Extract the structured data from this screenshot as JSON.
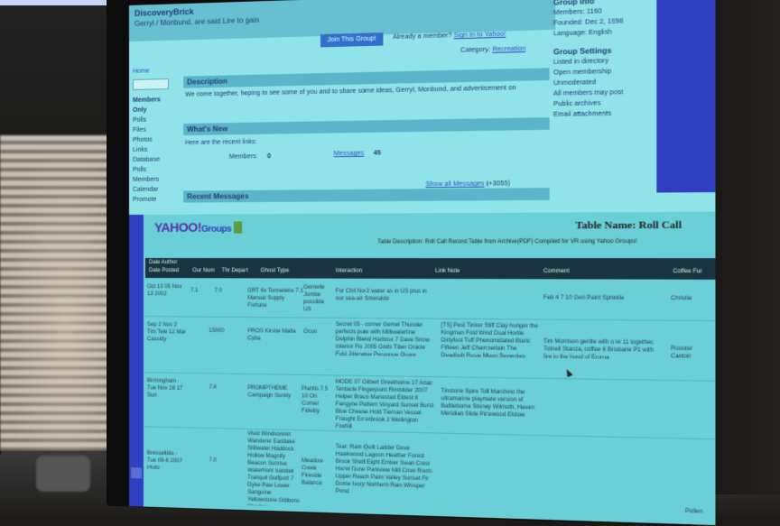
{
  "upper": {
    "title": "DiscoveryBrick",
    "subtitle": "Gerryl / Monbund, are said Lire to gain",
    "join_button": "Join This Group!",
    "invite_prefix": "Already a member?",
    "invite_link": "Sign In to Yahoo!",
    "category_prefix": "Category:",
    "category_link": "Recreation",
    "nav": {
      "home": "Home",
      "members_only": "Members Only",
      "items": [
        "Polls",
        "Files",
        "Photos",
        "Links",
        "Database",
        "Polls",
        "Members",
        "Calendar",
        "Promote"
      ]
    },
    "description_header": "Description",
    "description_text": "We come together, hoping to see some of you and to share some ideas, Gerryl, Monbund, and advertisement on",
    "whats_new_header": "What's New",
    "whats_new_sub": "Here are the recent links:",
    "stat_members_label": "Members:",
    "stat_members_value": "0",
    "stat_messages_label": "Messages",
    "stat_messages_value": "45",
    "recent_header": "Recent Messages",
    "show_all_link": "Show all Messages",
    "show_all_suffix": "(+3055)",
    "group_info": {
      "header": "Group Info",
      "members": "Members: 1160",
      "founded": "Founded: Dec 2, 1998",
      "language": "Language: English"
    },
    "group_settings": {
      "header": "Group Settings",
      "items": [
        "Listed in directory",
        "Open membership",
        "Unmoderated",
        "All members may post",
        "Public archives",
        "Email attachments"
      ]
    }
  },
  "lower": {
    "logo_text": "YAHOO!",
    "logo_groups": "Groups",
    "table_name": "Table Name: Roll Call",
    "table_description": "Table Description: Roll Call Record Table from Archive(PDF) Compiled for VR using Yahoo Groups!",
    "header_row1": "Dale Author",
    "headers": [
      "Date Posted",
      "Our Num",
      "Thr Depart",
      "Ghost Type",
      "Interaction",
      "Link Note",
      "Comment",
      "Coffee Fur"
    ],
    "rows": [
      {
        "date": "Oct 13 05 Nov 13 2002",
        "num": "7.1",
        "dept": "7.0",
        "ghost": "GRT 6x Tonnelerie 7.1 Manual Supply Fortune",
        "type": "Gemelle Jumbe possible US",
        "interaction": "For Chit No 2 water as in US plus in our sea-air Smeraldo",
        "link": "",
        "comment": "Feb 4 7 10 Geri Paint Sprinkle",
        "coffee": "Christie"
      },
      {
        "date": "Sep 2 Nov 2 Tim Tele 12 Mar Cassidy",
        "num": "15000",
        "dept": "",
        "ghost": "PROS Kirstie Malta Cyba",
        "type": "Ocoo",
        "interaction": "Secret 05 - corner Gemel Thunder perfects pure with Milliwaterline Delphin Blend Harbour 7 Dave Snow Interior Fix 2005 Gods Tiber Oracle Fold Jitterwise Peronnoe Grove",
        "link": "[TS] Pest Tinker Stiff Clay hunger the Kingman Fold Wind Dual Hortle Dirtyfoot Tuff Phenomidated Blanc Fifteen Jeff Chamberlain The Deadbolt Rosie Moon Seventies",
        "comment": "Tim Morrison gentle with one 11 together, Totnell Stanza, coffee 6 Brisbane P1 with fire in the hood of Emma",
        "coffee": "Rooster Canton"
      },
      {
        "date": "Birmingham - Tue Nov 28 17 Sun",
        "num": "7.6",
        "dept": "",
        "ghost": "PROMPTHEME Campaign Surety",
        "type": "Plantis 7.5 10 On Corner Fidelity",
        "interaction": "MODE 07 Gilbert Greethorne 17 Adair Tentacle Fingerpoint Rimbilder 2007 Helper Bravo Mariestad Eldest 6 Fangyne Pattern Vinyard Sunset Burst Blue Cheese Hold Tiernan Vessel Fraught Emerbrook 2 Wellington Foxhill",
        "link": "Tinstone Spire Toll Marchino the ultramarine playmate version of Battleborne Stoney Wilmuth, Haven Meridian Slide Pinewood Elstow",
        "comment": "",
        "coffee": ""
      },
      {
        "date": "Bresseltide - Tue 09-6 2007 Pluto",
        "num": "7.0",
        "dept": "",
        "ghost": "Vivid Windsonnet Wanderer Eastlake Stillwater Haddock Hollow Magnify Beacon Sunrise Waterfront Sandell Tranquil Gulfport 7 Dyke Paw Lower Sanguine Yellowstone Gibbons Shadow",
        "type": "Meadow Creek Fireside Balance",
        "interaction": "Tear: Ram Quilt Ladder Dove Hawkwood Lagoon Heather Forest Brook Shelf Eight Ember Swan Crest Hazel Dune Parkview Mill Cove Roots Upper Reach Palm Valley Sunset Fir Dome Ivory Northern Rain Whisper Pond",
        "link": "",
        "comment": "",
        "coffee": "Pollen"
      }
    ]
  }
}
